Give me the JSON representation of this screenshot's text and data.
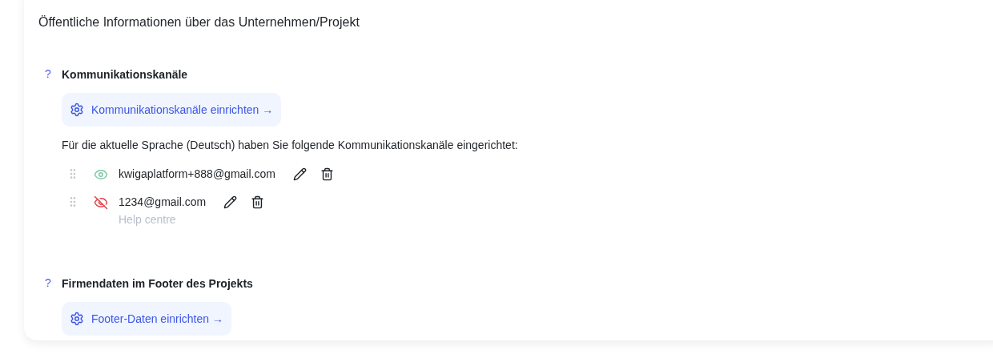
{
  "heading": "Öffentliche Informationen über das Unternehmen/Projekt",
  "sections": [
    {
      "help": "?",
      "title": "Kommunikationskanäle",
      "button": "Kommunikationskanäle einrichten →",
      "description": "Für die aktuelle Sprache (Deutsch) haben Sie folgende Kommunikationskanäle eingerichtet:",
      "channels": [
        {
          "value": "kwigaplatform+888@gmail.com",
          "visible": true
        },
        {
          "value": "1234@gmail.com",
          "visible": false,
          "subtitle": "Help centre"
        }
      ]
    },
    {
      "help": "?",
      "title": "Firmendaten im Footer des Projekts",
      "button": "Footer-Daten einrichten →"
    }
  ]
}
